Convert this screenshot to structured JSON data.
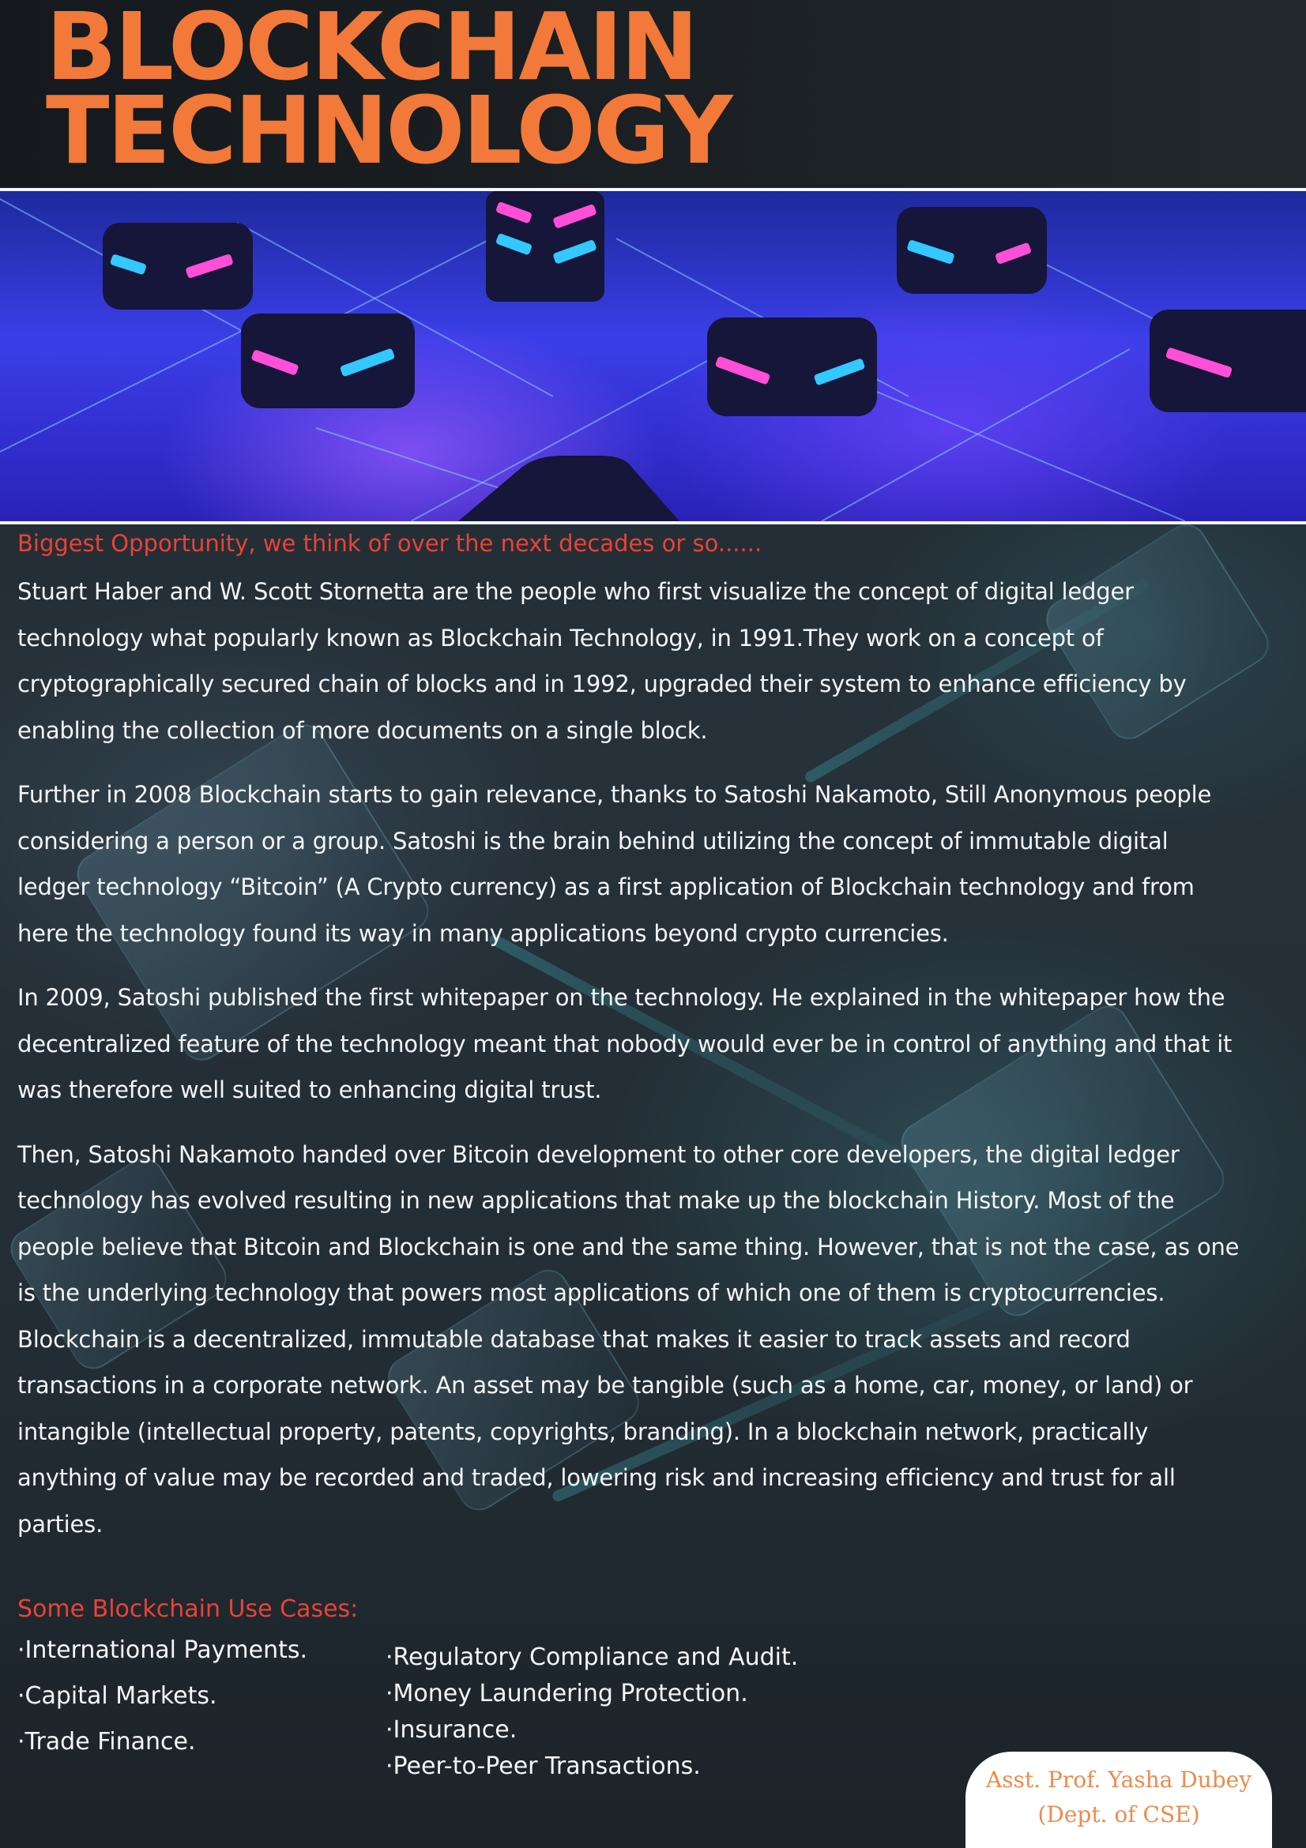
{
  "header": {
    "title_line1": "BLOCKCHAIN",
    "title_line2": "TECHNOLOGY",
    "title_color": "#f2793a"
  },
  "hero_image": {
    "icon": "blockchain-nodes-illustration",
    "accent_colors": [
      "#3b3ee8",
      "#ff4fd8",
      "#33c8ff"
    ]
  },
  "tagline": "Biggest Opportunity, we think of over the next decades or so......",
  "paragraphs": [
    [
      "Stuart Haber and W. Scott Stornetta are the people who first visualize the concept of digital ledger",
      "technology what popularly known as Blockchain Technology, in 1991.They work on a concept of",
      "cryptographically secured chain of blocks and  in 1992,  upgraded their system to enhance efficiency by",
      "enabling the collection of more documents on a single block."
    ],
    [
      "Further in 2008 Blockchain starts to gain relevance, thanks to Satoshi Nakamoto, Still Anonymous people",
      "considering a person or a group. Satoshi is the brain behind utilizing the concept of immutable digital",
      "ledger technology “Bitcoin” (A Crypto currency) as a first application of Blockchain technology and from",
      "here the technology found its way in many applications beyond crypto currencies."
    ],
    [
      "In 2009, Satoshi published the first whitepaper on the technology. He explained in the whitepaper how the",
      "decentralized feature of the technology meant that nobody would ever be in control of anything and that it",
      "was therefore well suited to enhancing digital trust."
    ],
    [
      "Then, Satoshi Nakamoto handed over Bitcoin development to other core developers, the digital ledger",
      "technology has evolved resulting in new applications that make up the blockchain History. Most of the",
      "people believe that Bitcoin and Blockchain is one and the same thing. However, that is not the case, as one",
      "is the underlying technology that powers most applications of which one of them is cryptocurrencies.",
      "Blockchain is a decentralized, immutable database that makes it easier to track assets and record",
      "transactions in a corporate network. An asset may be tangible (such as a home, car, money, or land) or",
      "intangible (intellectual property, patents, copyrights, branding). In a blockchain network, practically",
      "anything of value may be recorded and traded, lowering risk and increasing efficiency and trust for all",
      "parties."
    ]
  ],
  "use_cases": {
    "title": "Some Blockchain Use Cases:",
    "left": [
      "·International Payments.",
      "·Capital Markets.",
      "·Trade Finance."
    ],
    "right": [
      "·Regulatory Compliance and Audit.",
      "·Money Laundering Protection.",
      "·Insurance.",
      "·Peer-to-Peer Transactions."
    ]
  },
  "author": {
    "line1": "Asst. Prof. Yasha Dubey",
    "line2": "(Dept. of CSE)"
  },
  "colors": {
    "accent_red": "#ea4335",
    "author_text": "#ef8a4c",
    "body_text": "#f4f6f8"
  }
}
